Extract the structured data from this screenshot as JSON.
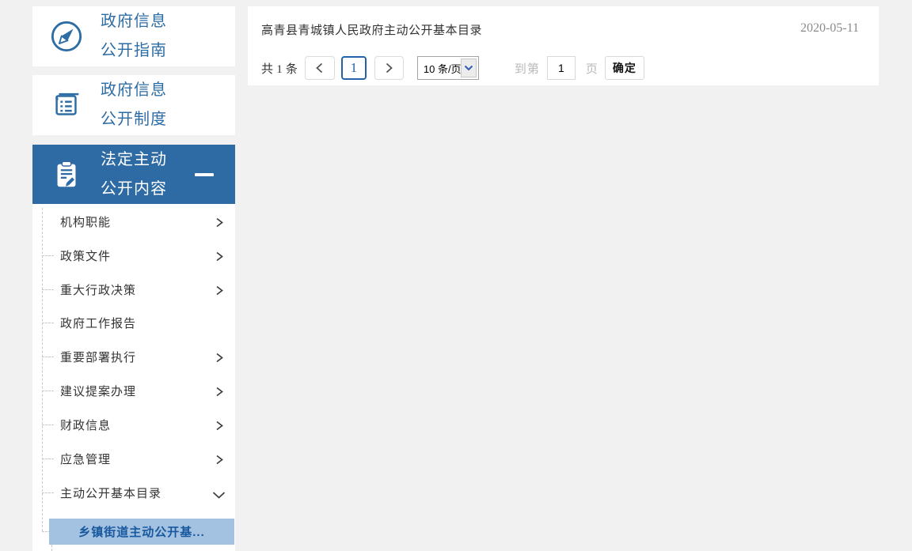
{
  "colors": {
    "page_background": "#f1f1f1",
    "brand_blue": "#2e6da4",
    "active_card_background": "#2e6aa3",
    "active_subitem_background": "#a3c1e0",
    "active_subitem_text": "#17589e",
    "muted_text": "#b9b9b9",
    "date_text": "#8a8a8a"
  },
  "sidebar": {
    "sections": [
      {
        "icon": "compass-icon",
        "line1": "政府信息",
        "line2": "公开指南",
        "active": false
      },
      {
        "icon": "book-list-icon",
        "line1": "政府信息",
        "line2": "公开制度",
        "active": false
      },
      {
        "icon": "clipboard-pencil-icon",
        "line1": "法定主动",
        "line2": "公开内容",
        "active": true,
        "collapse_icon": "minus-icon"
      }
    ],
    "submenu": {
      "items": [
        {
          "label": "机构职能",
          "chevron": "right"
        },
        {
          "label": "政策文件",
          "chevron": "right"
        },
        {
          "label": "重大行政决策",
          "chevron": "right"
        },
        {
          "label": "政府工作报告",
          "chevron": "none"
        },
        {
          "label": "重要部署执行",
          "chevron": "right"
        },
        {
          "label": "建议提案办理",
          "chevron": "right"
        },
        {
          "label": "财政信息",
          "chevron": "right"
        },
        {
          "label": "应急管理",
          "chevron": "right"
        },
        {
          "label": "主动公开基本目录",
          "chevron": "down"
        }
      ],
      "active_subitem": {
        "label": "乡镇街道主动公开基..."
      }
    }
  },
  "main": {
    "list": [
      {
        "title": "高青县青城镇人民政府主动公开基本目录",
        "date": "2020-05-11"
      }
    ],
    "pagination": {
      "total_prefix": "共",
      "total_count": "1",
      "total_suffix": "条",
      "current_page": "1",
      "page_size_value": "10 条/页",
      "goto_prefix": "到第",
      "goto_value": "1",
      "goto_suffix": "页",
      "confirm_label": "确定"
    }
  }
}
